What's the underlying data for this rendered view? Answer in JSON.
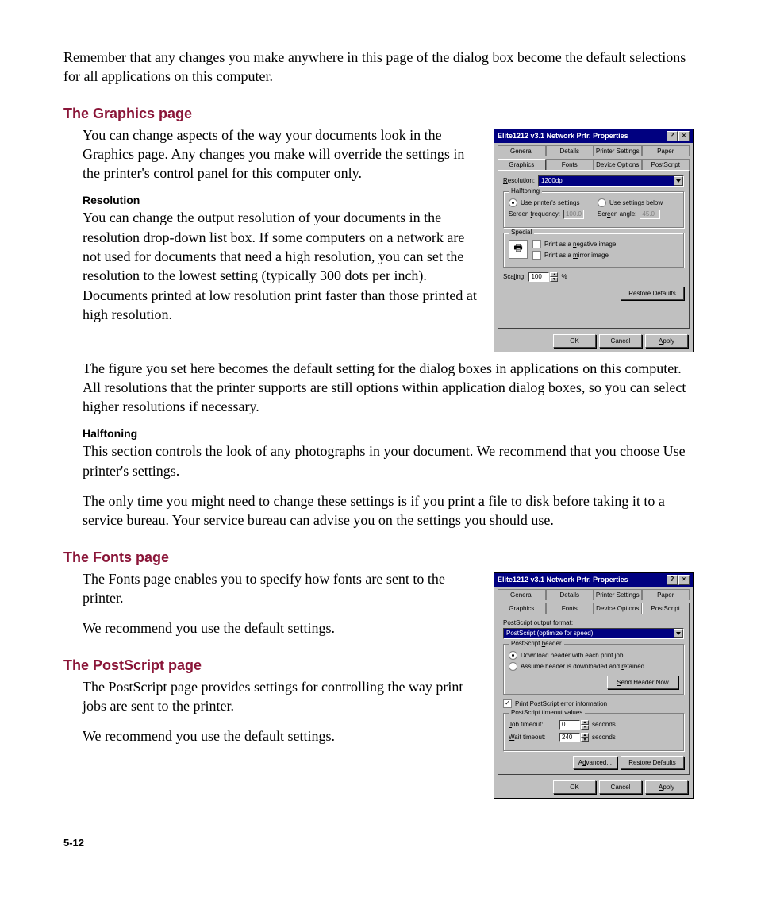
{
  "intro": "Remember that any changes you make anywhere in this page of the dialog box become the default selections for all applications on this computer.",
  "graphics": {
    "heading": "The Graphics page",
    "para1": "You can change aspects of the way your documents look in the Graphics page. Any changes you make will override the settings in the printer's control panel for this computer only.",
    "resolution_heading": "Resolution",
    "resolution_para1": "You can change the output resolution of your documents in the resolution drop-down list box. If some computers on a network are not used for documents that need a high resolution, you can set the resolution to the lowest setting (typically 300 dots per inch). Documents printed at low resolution print faster than those printed at high resolution.",
    "resolution_para2": "The figure you set here becomes the default setting for the dialog boxes in applications on this computer. All resolutions that the printer supports are still options within application dialog boxes, so you can select higher resolutions if necessary.",
    "halftoning_heading": "Halftoning",
    "halftoning_para1": "This section controls the look of any photographs in your document. We recommend that you choose Use printer's settings.",
    "halftoning_para2": "The only time you might need to change these settings is if you print a file to disk before taking it to a service bureau. Your service bureau can advise you on the settings you should use."
  },
  "fonts": {
    "heading": "The Fonts page",
    "para1": "The Fonts page enables you to specify how fonts are sent to the printer.",
    "para2": "We recommend you use the default settings."
  },
  "postscript": {
    "heading": "The PostScript page",
    "para1": "The PostScript page provides settings for controlling the way print jobs are sent to the printer.",
    "para2": "We recommend you use the default settings."
  },
  "page_num": "5-12",
  "dlg1": {
    "title": "Elite1212 v3.1 Network Prtr. Properties",
    "tabs_row1": [
      "General",
      "Details",
      "Printer Settings",
      "Paper"
    ],
    "tabs_row2": [
      "Graphics",
      "Fonts",
      "Device Options",
      "PostScript"
    ],
    "active_tab": "Graphics",
    "resolution_label": "Resolution:",
    "resolution_value": "1200dpi",
    "halftoning_label": "Halftoning",
    "use_printer": "Use printer's settings",
    "use_below": "Use settings below",
    "screen_freq_label": "Screen frequency:",
    "screen_freq_value": "100.0",
    "screen_angle_label": "Screen angle:",
    "screen_angle_value": "45.0",
    "special_label": "Special",
    "neg_label": "Print as a negative image",
    "mirror_label": "Print as a mirror image",
    "scaling_label": "Scaling:",
    "scaling_value": "100",
    "scaling_unit": "%",
    "restore": "Restore Defaults",
    "ok": "OK",
    "cancel": "Cancel",
    "apply": "Apply"
  },
  "dlg2": {
    "title": "Elite1212 v3.1 Network Prtr. Properties",
    "tabs_row1": [
      "General",
      "Details",
      "Printer Settings",
      "Paper"
    ],
    "tabs_row2": [
      "Graphics",
      "Fonts",
      "Device Options",
      "PostScript"
    ],
    "active_tab": "PostScript",
    "output_label": "PostScript output format:",
    "output_value": "PostScript (optimize for speed)",
    "header_group": "PostScript header",
    "header_opt1": "Download header with each print job",
    "header_opt2": "Assume header is downloaded and retained",
    "send_header": "Send Header Now",
    "print_error": "Print PostScript error information",
    "timeout_group": "PostScript timeout values",
    "job_label": "Job timeout:",
    "job_value": "0",
    "wait_label": "Wait timeout:",
    "wait_value": "240",
    "seconds": "seconds",
    "advanced": "Advanced...",
    "restore": "Restore Defaults",
    "ok": "OK",
    "cancel": "Cancel",
    "apply": "Apply"
  }
}
